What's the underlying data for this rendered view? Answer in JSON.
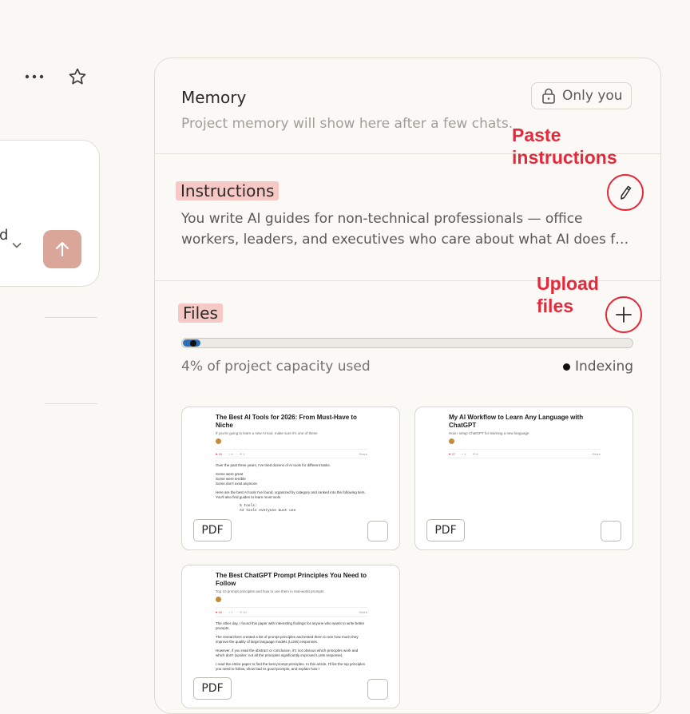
{
  "composer": {
    "model_fragment": "d"
  },
  "memory": {
    "title": "Memory",
    "description": "Project memory will show here after a few chats.",
    "visibility_label": "Only you"
  },
  "instructions": {
    "title": "Instructions",
    "text_line1": "You write AI guides for non-technical professionals — office",
    "text_line2": "workers, leaders, and executives who care about what AI does fo…"
  },
  "files": {
    "title": "Files",
    "capacity_percent": 4,
    "capacity_text": "4% of project capacity used",
    "status": "Indexing",
    "items": [
      {
        "type": "PDF",
        "title": "The Best AI Tools for 2026: From Must-Have to Niche",
        "subtitle": "If you're going to learn a new AI tool, make sure it's one of these",
        "stats": [
          "♥ 45",
          "○ 6",
          "⟲ 1",
          "Share"
        ],
        "body": [
          "Over the past three years, I've tried dozens of AI tools for different tasks.",
          "Some were great",
          "Some were terrible",
          "Some don't exist anymore",
          "Here are the best AI tools I've found, organized by category and ranked into the following tiers. You'll also find guides to learn most tools.",
          "S tools:",
          "AI tools everyone must use"
        ]
      },
      {
        "type": "PDF",
        "title": "My AI Workflow to Learn Any Language with ChatGPT",
        "subtitle": "How I setup ChatGPT for learning a new language",
        "stats": [
          "♥ 37",
          "○ 1",
          "⟲ 6",
          "Share"
        ],
        "body": []
      },
      {
        "type": "PDF",
        "title": "The Best ChatGPT Prompt Principles You Need to Follow",
        "subtitle": "Top 10 prompt principles and how to use them in real-world prompts",
        "stats": [
          "♥ 66",
          "○ 1",
          "⟲ 10",
          "Share"
        ],
        "body": [
          "The other day, I found this paper with interesting findings for anyone who wants to write better prompts.",
          "The researchers created a list of prompt principles and tested them to see how much they improve the quality of large language models (LLMs) responses.",
          "However, if you read the abstract or conclusion, it's not obvious which principles work and which don't (spoiler: not all the principles significantly improved LLMs response).",
          "I read the entire paper to find the best prompt principles. In this article, I'll list the top principles you need to follow, show bad vs good prompts, and explain how I"
        ]
      }
    ]
  },
  "annotations": {
    "paste_label": "Paste\ninstructions",
    "upload_label": "Upload\nfiles"
  },
  "colors": {
    "accent_red": "#e5293a",
    "highlight": "#f6c9c6",
    "send_button": "#dba69a",
    "capacity_fill": "#2e6fb8"
  }
}
